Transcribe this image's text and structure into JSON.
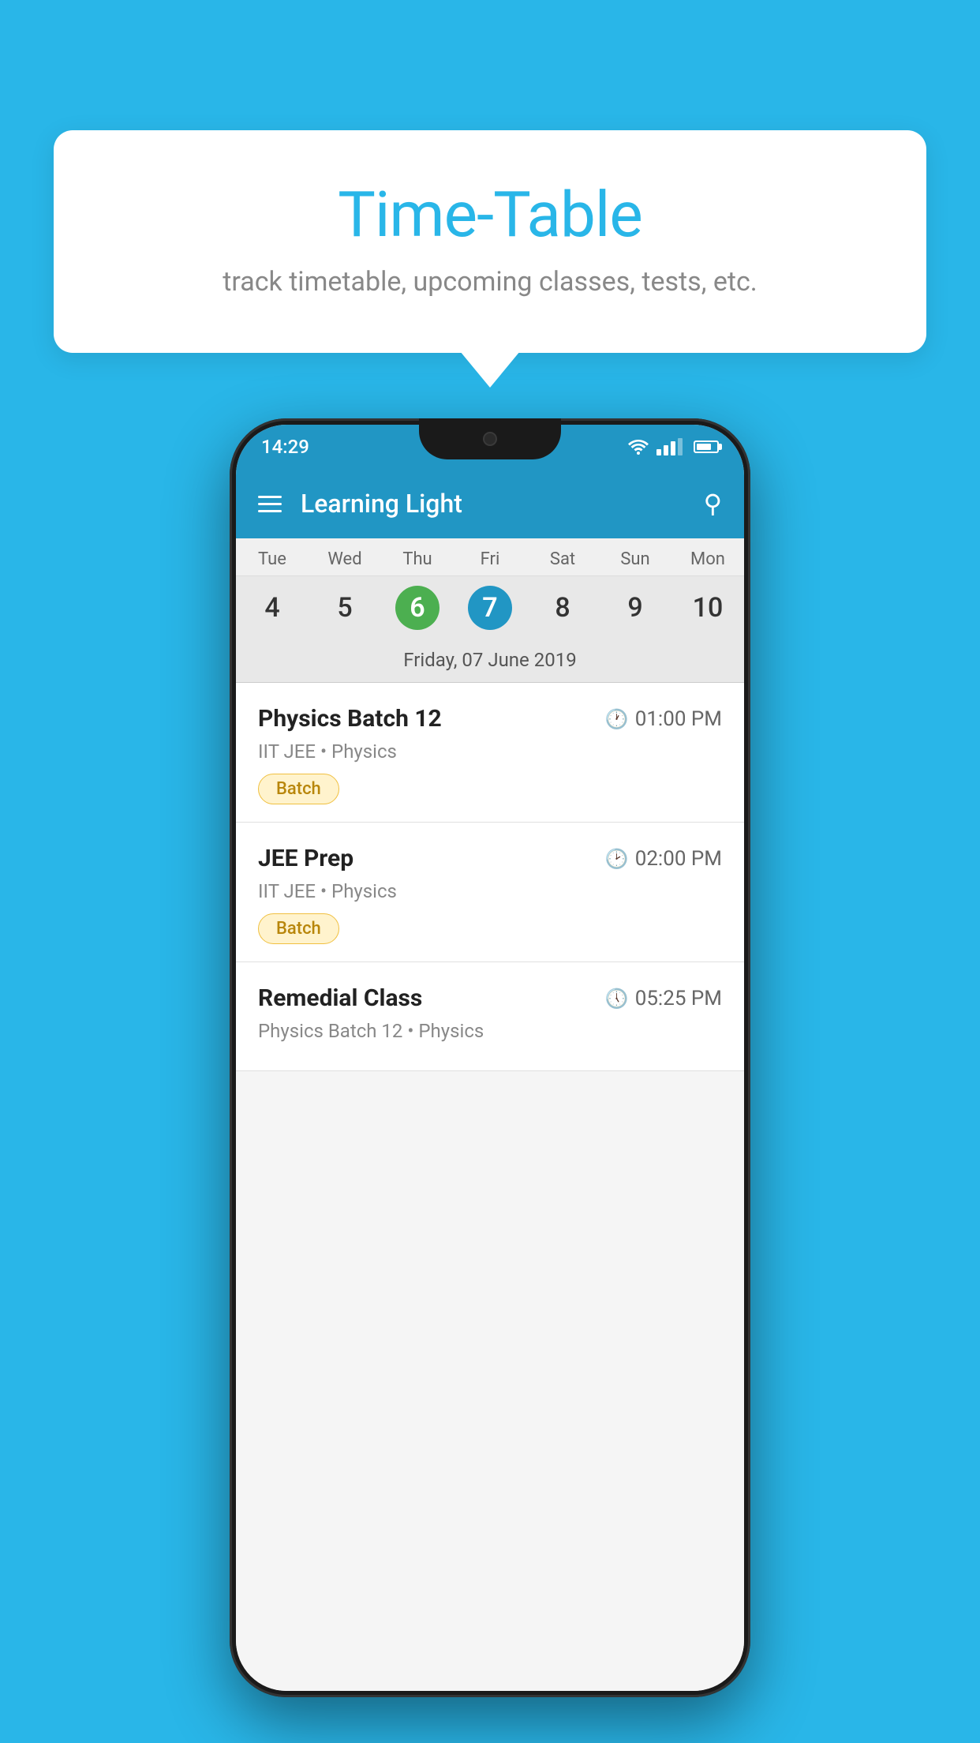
{
  "background_color": "#29B6E8",
  "bubble": {
    "title": "Time-Table",
    "subtitle": "track timetable, upcoming classes, tests, etc."
  },
  "phone": {
    "status_bar": {
      "time": "14:29"
    },
    "app_bar": {
      "title": "Learning Light"
    },
    "calendar": {
      "days": [
        {
          "abbr": "Tue",
          "num": "4"
        },
        {
          "abbr": "Wed",
          "num": "5"
        },
        {
          "abbr": "Thu",
          "num": "6",
          "style": "green"
        },
        {
          "abbr": "Fri",
          "num": "7",
          "style": "blue"
        },
        {
          "abbr": "Sat",
          "num": "8"
        },
        {
          "abbr": "Sun",
          "num": "9"
        },
        {
          "abbr": "Mon",
          "num": "10"
        }
      ],
      "selected_date": "Friday, 07 June 2019"
    },
    "schedule": [
      {
        "title": "Physics Batch 12",
        "time": "01:00 PM",
        "meta": "IIT JEE • Physics",
        "badge": "Batch"
      },
      {
        "title": "JEE Prep",
        "time": "02:00 PM",
        "meta": "IIT JEE • Physics",
        "badge": "Batch"
      },
      {
        "title": "Remedial Class",
        "time": "05:25 PM",
        "meta": "Physics Batch 12 • Physics",
        "badge": null
      }
    ]
  }
}
